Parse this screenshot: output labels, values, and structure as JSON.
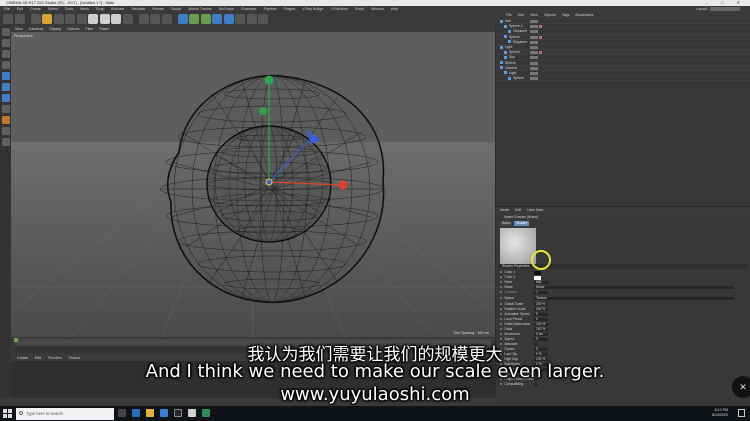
{
  "window": {
    "title": "CINEMA 4D R17.052 Studio (RC - R17) - [Untitled 1 *] - Main",
    "controls": "–  □  ✕"
  },
  "menubar": {
    "items": [
      "File",
      "Edit",
      "Create",
      "Select",
      "Tools",
      "Mesh",
      "Snap",
      "Animate",
      "Simulate",
      "Render",
      "Sculpt",
      "Motion Tracker",
      "MoGraph",
      "Character",
      "Pipeline",
      "Plugins",
      "V-Ray Bridge",
      "X-Particles",
      "Script",
      "Window",
      "Help"
    ],
    "layout_label": "Layout:"
  },
  "viewport": {
    "menu": [
      "View",
      "Cameras",
      "Display",
      "Options",
      "Filter",
      "Panel"
    ],
    "label": "Perspective",
    "grid_spacing": "Grid Spacing : 100 cm"
  },
  "materials": {
    "menu": [
      "Create",
      "Edit",
      "Function",
      "Texture"
    ]
  },
  "object_manager": {
    "menu": [
      "File",
      "Edit",
      "View",
      "Objects",
      "Tags",
      "Bookmarks"
    ],
    "objects": [
      {
        "name": "Null"
      },
      {
        "name": "Sphere.1"
      },
      {
        "name": "Displacer"
      },
      {
        "name": "Sphere"
      },
      {
        "name": "Displacer"
      },
      {
        "name": "Light"
      },
      {
        "name": "Sphere"
      },
      {
        "name": "Sky"
      },
      {
        "name": "Sphere"
      },
      {
        "name": "Camera"
      },
      {
        "name": "Light"
      },
      {
        "name": "Sphere"
      }
    ]
  },
  "attribute_manager": {
    "menu": [
      "Mode",
      "Edit",
      "User Data"
    ],
    "shader_title": "Noise Shader [Noise]",
    "tabs": [
      "Basic",
      "Shader"
    ],
    "active_tab": "Shader",
    "section": "Shader Properties",
    "properties": [
      {
        "label": "Color 1",
        "value": ""
      },
      {
        "label": "Color 2",
        "value": ""
      },
      {
        "label": "Seed",
        "value": "665"
      },
      {
        "label": "Noise",
        "value": "Noise"
      },
      {
        "label": "Octaves",
        "value": "5"
      },
      {
        "label": "Space",
        "value": "Texture"
      },
      {
        "label": "Global Scale",
        "value": "200 %"
      },
      {
        "label": "Relative Scale",
        "value": "100 %"
      },
      {
        "label": "Animation Speed",
        "value": "0"
      },
      {
        "label": "Loop Period",
        "value": "0"
      },
      {
        "label": "Detail Attenuation",
        "value": "100 %"
      },
      {
        "label": "Delta",
        "value": "100 %"
      },
      {
        "label": "Movement",
        "value": "0 cm"
      },
      {
        "label": "Speed",
        "value": "0"
      },
      {
        "label": "Absolute",
        "value": ""
      },
      {
        "label": "Cycles",
        "value": "0"
      },
      {
        "label": "Low Clip",
        "value": "0 %"
      },
      {
        "label": "High Clip",
        "value": "100 %"
      },
      {
        "label": "Brightness",
        "value": "0 %"
      },
      {
        "label": "Contrast",
        "value": "0 %"
      },
      {
        "label": "Use as Environment",
        "value": ""
      },
      {
        "label": "Project Environment",
        "value": ""
      },
      {
        "label": "Compatibility",
        "value": ""
      }
    ]
  },
  "taskbar": {
    "search_placeholder": "Type here to search",
    "time": "8:12 PM",
    "date": "8/13/2020"
  },
  "subtitles": {
    "chinese": "我认为我们需要让我们的规模更大",
    "english": "And I think we need to make our scale even larger.",
    "url": "www.yuyulaoshi.com"
  },
  "colors": {
    "viewport_bg": "#5b5b5b",
    "mesh": "#1a1a1a",
    "axis_x": "#d9432b",
    "axis_y": "#2ca84a",
    "axis_z": "#3a5fd6",
    "highlight": "#e8e33a"
  }
}
